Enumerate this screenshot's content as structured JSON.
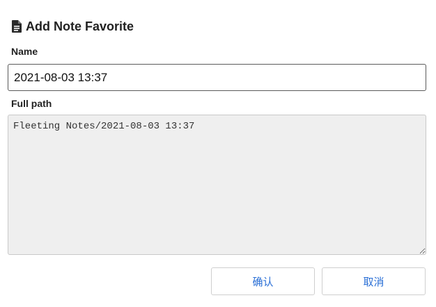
{
  "dialog": {
    "title": "Add Note Favorite",
    "title_icon": "document-icon"
  },
  "form": {
    "name_label": "Name",
    "name_value": "2021-08-03 13:37",
    "path_label": "Full path",
    "path_value": "Fleeting Notes/2021-08-03 13:37"
  },
  "buttons": {
    "confirm_label": "确认",
    "cancel_label": "取消"
  },
  "colors": {
    "button_text": "#2a6fd6",
    "readonly_background": "#efefef"
  }
}
